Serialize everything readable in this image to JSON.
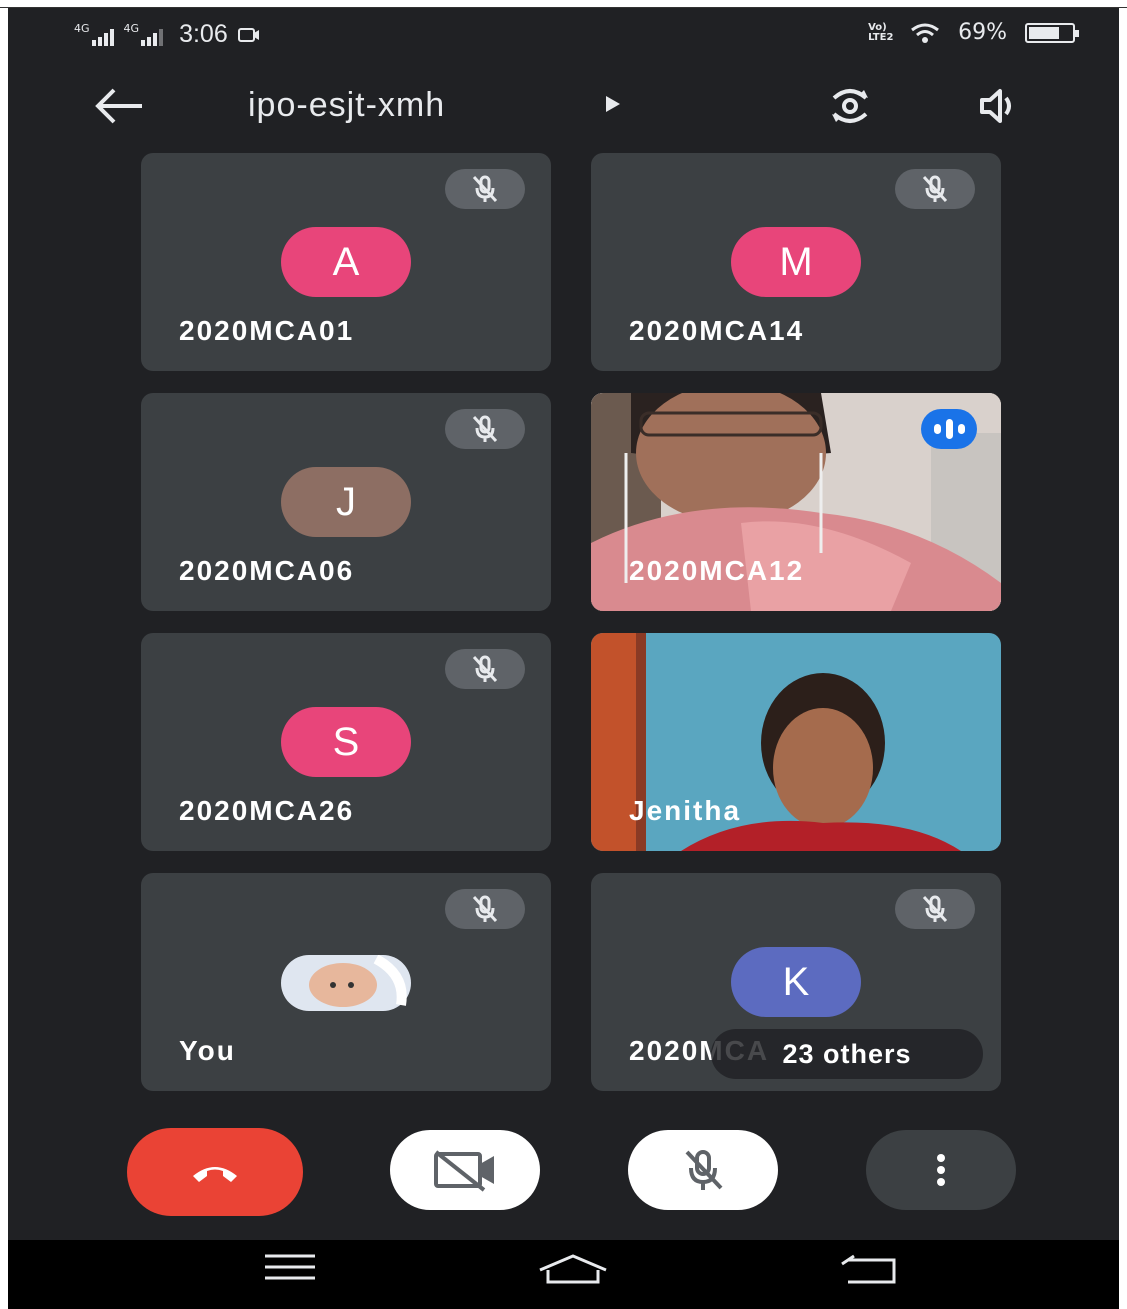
{
  "status_bar": {
    "signal_1": "4G",
    "signal_2": "4G",
    "time": "3:06",
    "lte": "Vo) LTE2",
    "battery": "69%"
  },
  "header": {
    "meeting_code": "ipo-esjt-xmh",
    "icons": {
      "back": "arrow-left-icon",
      "switch_camera": "switch-camera-icon",
      "speaker": "speaker-icon"
    }
  },
  "participants": [
    {
      "name": "2020MCA01",
      "initial": "A",
      "avatar_color": "#e8457a",
      "muted": true
    },
    {
      "name": "2020MCA14",
      "initial": "M",
      "avatar_color": "#e8457a",
      "muted": true
    },
    {
      "name": "2020MCA06",
      "initial": "J",
      "avatar_color": "#8d6e63",
      "muted": true
    },
    {
      "name": "2020MCA12",
      "video": true,
      "speaking": true
    },
    {
      "name": "2020MCA26",
      "initial": "S",
      "avatar_color": "#e8457a",
      "muted": true
    },
    {
      "name": "Jenitha",
      "video": true
    },
    {
      "name": "You",
      "photo_avatar": true,
      "muted": true
    },
    {
      "name": "2020MCA",
      "initial": "K",
      "avatar_color": "#5c6bc0",
      "muted": true,
      "overlay": "23 others"
    }
  ],
  "controls": {
    "end_call": "end-call-icon",
    "camera": "camera-off-icon",
    "microphone": "mic-off-icon",
    "more": "more-vert-icon"
  },
  "colors": {
    "background": "#202124",
    "tile": "#3c4043",
    "end_call": "#ea4335",
    "speaking": "#1a73e8"
  }
}
